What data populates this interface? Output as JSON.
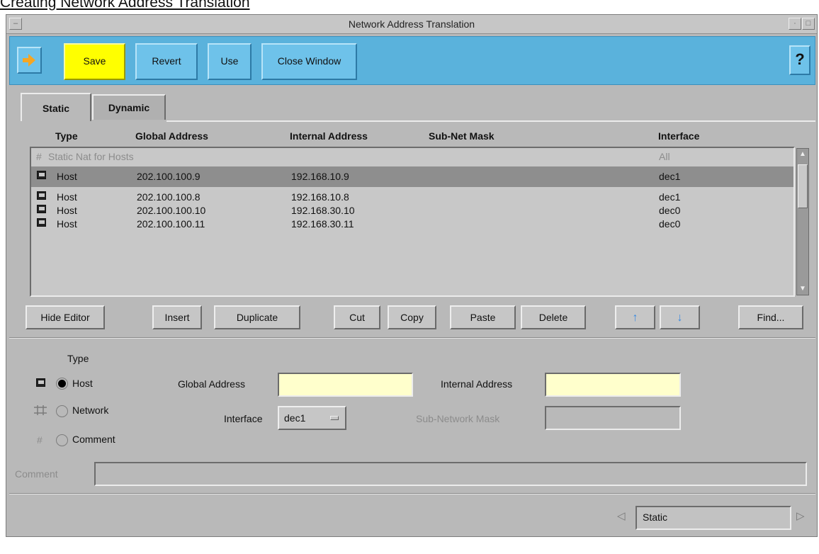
{
  "page": {
    "heading": "Creating Network Address Translation"
  },
  "window": {
    "title": "Network Address Translation"
  },
  "toolbar": {
    "save": "Save",
    "revert": "Revert",
    "use": "Use",
    "close": "Close Window",
    "help": "?"
  },
  "tabs": {
    "static": "Static",
    "dynamic": "Dynamic"
  },
  "table": {
    "columns": {
      "type": "Type",
      "global": "Global Address",
      "internal": "Internal Address",
      "mask": "Sub-Net Mask",
      "interface": "Interface"
    },
    "rows": [
      {
        "type": "Static Nat for Hosts",
        "global": "",
        "internal": "",
        "mask": "",
        "interface": "All",
        "icon": "hash-icon"
      },
      {
        "type": "Host",
        "global": "202.100.100.9",
        "internal": "192.168.10.9",
        "mask": "",
        "interface": "dec1",
        "icon": "host-icon"
      },
      {
        "type": "Host",
        "global": "202.100.100.8",
        "internal": "192.168.10.8",
        "mask": "",
        "interface": "dec1",
        "icon": "host-icon"
      },
      {
        "type": "Host",
        "global": "202.100.100.10",
        "internal": "192.168.30.10",
        "mask": "",
        "interface": "dec0",
        "icon": "host-icon"
      },
      {
        "type": "Host",
        "global": "202.100.100.11",
        "internal": "192.168.30.11",
        "mask": "",
        "interface": "dec0",
        "icon": "host-icon"
      }
    ]
  },
  "actions": {
    "hide_editor": "Hide Editor",
    "insert": "Insert",
    "duplicate": "Duplicate",
    "cut": "Cut",
    "copy": "Copy",
    "paste": "Paste",
    "delete": "Delete",
    "up": "↑",
    "down": "↓",
    "find": "Find..."
  },
  "editor": {
    "type_label": "Type",
    "types": {
      "host": "Host",
      "network": "Network",
      "comment": "Comment"
    },
    "global_address_label": "Global Address",
    "global_address_value": "",
    "internal_address_label": "Internal Address",
    "internal_address_value": "",
    "interface_label": "Interface",
    "interface_value": "dec1",
    "subnet_mask_label": "Sub-Network Mask",
    "subnet_mask_value": "",
    "comment_label": "Comment",
    "comment_value": ""
  },
  "status": {
    "value": "Static"
  }
}
